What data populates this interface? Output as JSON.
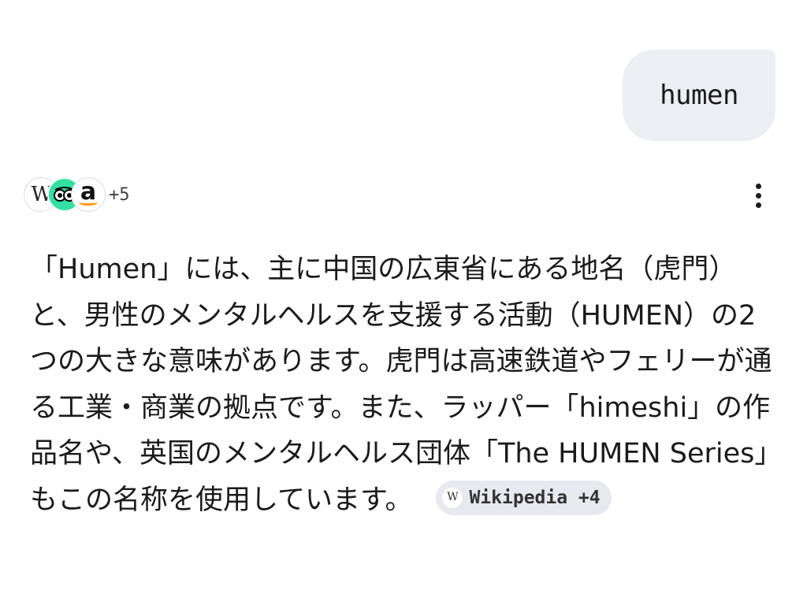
{
  "user_message": {
    "text": "humen"
  },
  "sources": {
    "icons": [
      {
        "name": "wikipedia-icon",
        "glyph": "W"
      },
      {
        "name": "tripadvisor-icon",
        "color": "#34e0a1"
      },
      {
        "name": "amazon-icon",
        "glyph": "a",
        "accent": "#ff9900"
      }
    ],
    "more_count": "+5"
  },
  "menu": {
    "icon": "more-vertical-icon"
  },
  "answer": {
    "text": "「Humen」には、主に中国の広東省にある地名（虎門）と、男性のメンタルヘルスを支援する活動（HUMEN）の2つの大きな意味があります。虎門は高速鉄道やフェリーが通る工業・商業の拠点です。また、ラッパー「himeshi」の作品名や、英国のメンタルヘルス団体「The HUMEN Series」もこの名称を使用しています。",
    "citation": {
      "icon_glyph": "W",
      "label": "Wikipedia +4"
    }
  }
}
